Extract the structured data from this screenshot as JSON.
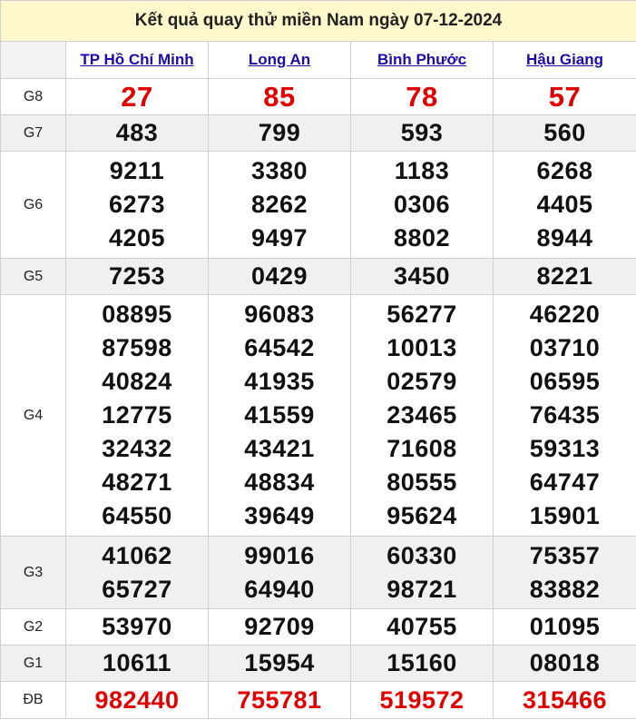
{
  "title": "Kết quả quay thử miền Nam ngày 07-12-2024",
  "provinces": [
    "TP Hồ Chí Minh",
    "Long An",
    "Bình Phước",
    "Hậu Giang"
  ],
  "rows": [
    {
      "label": "G8",
      "alt": false,
      "red": true,
      "big": true,
      "cells": [
        [
          "27"
        ],
        [
          "85"
        ],
        [
          "78"
        ],
        [
          "57"
        ]
      ]
    },
    {
      "label": "G7",
      "alt": true,
      "red": false,
      "big": false,
      "cells": [
        [
          "483"
        ],
        [
          "799"
        ],
        [
          "593"
        ],
        [
          "560"
        ]
      ]
    },
    {
      "label": "G6",
      "alt": false,
      "red": false,
      "big": false,
      "cells": [
        [
          "9211",
          "6273",
          "4205"
        ],
        [
          "3380",
          "8262",
          "9497"
        ],
        [
          "1183",
          "0306",
          "8802"
        ],
        [
          "6268",
          "4405",
          "8944"
        ]
      ]
    },
    {
      "label": "G5",
      "alt": true,
      "red": false,
      "big": false,
      "cells": [
        [
          "7253"
        ],
        [
          "0429"
        ],
        [
          "3450"
        ],
        [
          "8221"
        ]
      ]
    },
    {
      "label": "G4",
      "alt": false,
      "red": false,
      "big": false,
      "cells": [
        [
          "08895",
          "87598",
          "40824",
          "12775",
          "32432",
          "48271",
          "64550"
        ],
        [
          "96083",
          "64542",
          "41935",
          "41559",
          "43421",
          "48834",
          "39649"
        ],
        [
          "56277",
          "10013",
          "02579",
          "23465",
          "71608",
          "80555",
          "95624"
        ],
        [
          "46220",
          "03710",
          "06595",
          "76435",
          "59313",
          "64747",
          "15901"
        ]
      ]
    },
    {
      "label": "G3",
      "alt": true,
      "red": false,
      "big": false,
      "cells": [
        [
          "41062",
          "65727"
        ],
        [
          "99016",
          "64940"
        ],
        [
          "60330",
          "98721"
        ],
        [
          "75357",
          "83882"
        ]
      ]
    },
    {
      "label": "G2",
      "alt": false,
      "red": false,
      "big": false,
      "cells": [
        [
          "53970"
        ],
        [
          "92709"
        ],
        [
          "40755"
        ],
        [
          "01095"
        ]
      ]
    },
    {
      "label": "G1",
      "alt": true,
      "red": false,
      "big": false,
      "cells": [
        [
          "10611"
        ],
        [
          "15954"
        ],
        [
          "15160"
        ],
        [
          "08018"
        ]
      ]
    },
    {
      "label": "ĐB",
      "alt": false,
      "red": true,
      "big": false,
      "cells": [
        [
          "982440"
        ],
        [
          "755781"
        ],
        [
          "519572"
        ],
        [
          "315466"
        ]
      ]
    }
  ]
}
